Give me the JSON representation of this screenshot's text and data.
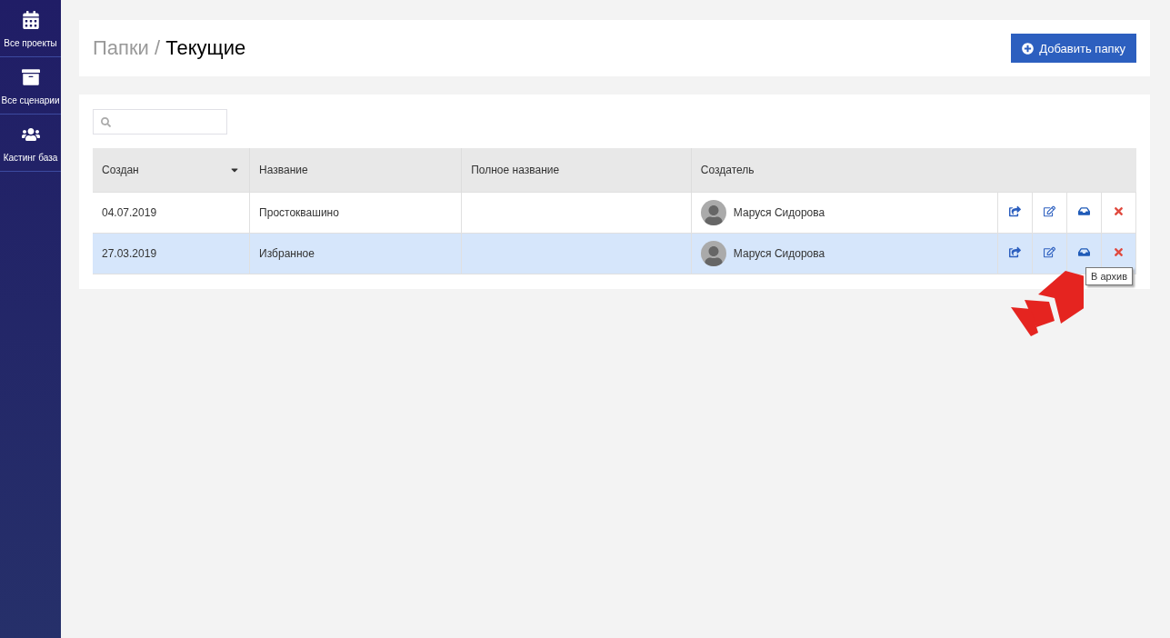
{
  "sidebar": {
    "items": [
      {
        "kind": "calendar",
        "label": "Все проекты"
      },
      {
        "kind": "archive",
        "label": "Все сценарии"
      },
      {
        "kind": "users",
        "label": "Кастинг база"
      }
    ]
  },
  "header": {
    "breadcrumb": "Папки",
    "separator": "/",
    "title": "Текущие",
    "add_button": "Добавить папку"
  },
  "table": {
    "columns": [
      {
        "label": "Создан",
        "sorted": true
      },
      {
        "label": "Название",
        "sorted": false
      },
      {
        "label": "Полное название",
        "sorted": false
      },
      {
        "label": "Создатель",
        "sorted": false
      }
    ],
    "rows": [
      {
        "created": "04.07.2019",
        "name": "Простоквашино",
        "full_name": "",
        "creator": "Маруся Сидорова",
        "selected": false
      },
      {
        "created": "27.03.2019",
        "name": "Избранное",
        "full_name": "",
        "creator": "Маруся Сидорова",
        "selected": true
      }
    ]
  },
  "tooltip": "В архив"
}
